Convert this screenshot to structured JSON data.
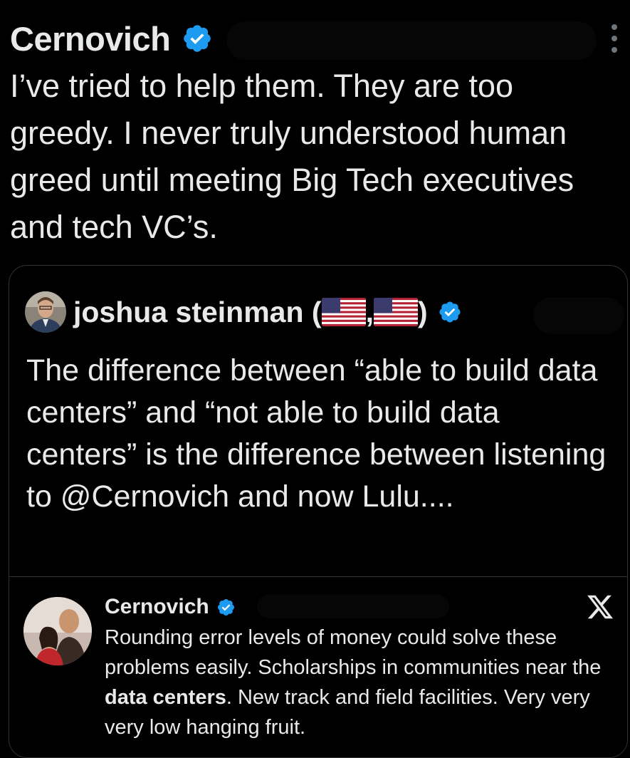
{
  "tweet": {
    "author": "Cernovich",
    "text": "I’ve tried to help them. They are too greedy. I never truly understood human greed until meeting Big Tech executives and tech VC’s."
  },
  "quote": {
    "author": "joshua steinman (",
    "author_sep": ",",
    "author_close": ")",
    "text": "The difference between “able to build data centers” and “not able to build data centers” is the difference between listening to @Cernovich and now Lulu....",
    "embed": {
      "author": "Cernovich",
      "text_before": "Rounding error levels of money could solve these problems easily. Scholarships in communities near the ",
      "text_bold": "data centers",
      "text_after": ". New track and field facilities. Very very very low hanging fruit."
    }
  },
  "colors": {
    "background": "#000000",
    "text": "#e7e9ea",
    "verified": "#1d9bf0",
    "border": "#2f3336"
  },
  "icons": [
    "verified-badge-icon",
    "more-options-icon",
    "us-flag-icon",
    "x-logo-icon"
  ]
}
